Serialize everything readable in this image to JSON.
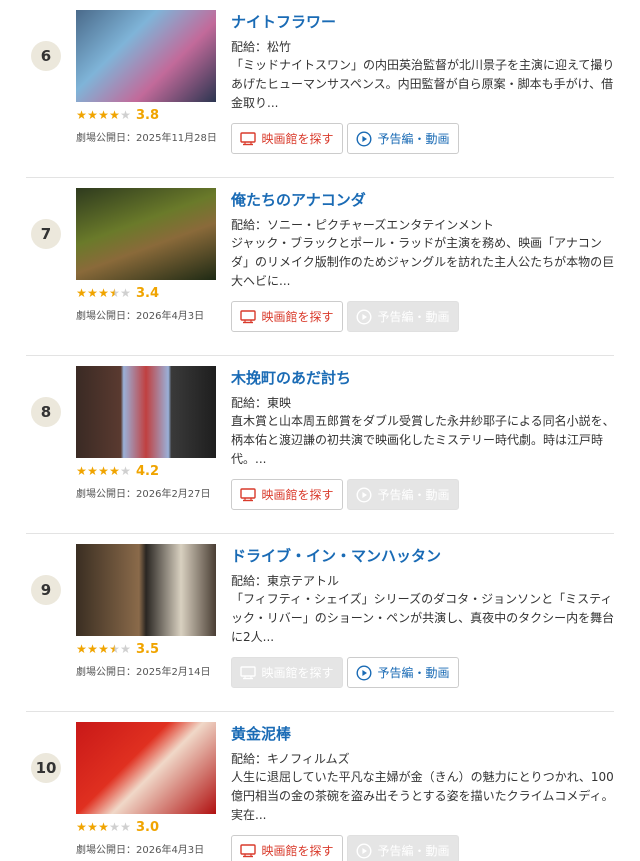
{
  "colors": {
    "title": "#1a6bb5",
    "star": "#f0a400",
    "theater_red": "#d93a2b",
    "disabled": "#e5e5e5"
  },
  "labels": {
    "theater_button": "映画館を探す",
    "trailer_button": "予告編・動画"
  },
  "movies": [
    {
      "rank": "6",
      "title": "ナイトフラワー",
      "distributor": "配給：松竹",
      "description": "「ミッドナイトスワン」の内田英治監督が北川景子を主演に迎えて撮りあげたヒューマンサスペンス。内田監督が自ら原案・脚本も手がけ、借金取り...",
      "rating": 3.8,
      "score": "3.8",
      "release": "劇場公開日：2025年11月28日",
      "theater_enabled": true,
      "trailer_enabled": true
    },
    {
      "rank": "7",
      "title": "俺たちのアナコンダ",
      "distributor": "配給：ソニー・ピクチャーズエンタテインメント",
      "description": "ジャック・ブラックとポール・ラッドが主演を務め、映画「アナコンダ」のリメイク版制作のためジャングルを訪れた主人公たちが本物の巨大ヘビに...",
      "rating": 3.4,
      "score": "3.4",
      "release": "劇場公開日：2026年4月3日",
      "theater_enabled": true,
      "trailer_enabled": false
    },
    {
      "rank": "8",
      "title": "木挽町のあだ討ち",
      "distributor": "配給：東映",
      "description": "直木賞と山本周五郎賞をダブル受賞した永井紗耶子による同名小説を、柄本佑と渡辺謙の初共演で映画化したミステリー時代劇。時は江戸時代。...",
      "rating": 4.2,
      "score": "4.2",
      "release": "劇場公開日：2026年2月27日",
      "theater_enabled": true,
      "trailer_enabled": false
    },
    {
      "rank": "9",
      "title": "ドライブ・イン・マンハッタン",
      "distributor": "配給：東京テアトル",
      "description": "「フィフティ・シェイズ」シリーズのダコタ・ジョンソンと「ミスティック・リバー」のショーン・ペンが共演し、真夜中のタクシー内を舞台に2人...",
      "rating": 3.5,
      "score": "3.5",
      "release": "劇場公開日：2025年2月14日",
      "theater_enabled": false,
      "trailer_enabled": true
    },
    {
      "rank": "10",
      "title": "黄金泥棒",
      "distributor": "配給：キノフィルムズ",
      "description": "人生に退屈していた平凡な主婦が金（きん）の魅力にとりつかれ、100億円相当の金の茶碗を盗み出そうとする姿を描いたクライムコメディ。実在...",
      "rating": 3.0,
      "score": "3.0",
      "release": "劇場公開日：2026年4月3日",
      "theater_enabled": true,
      "trailer_enabled": false
    }
  ]
}
